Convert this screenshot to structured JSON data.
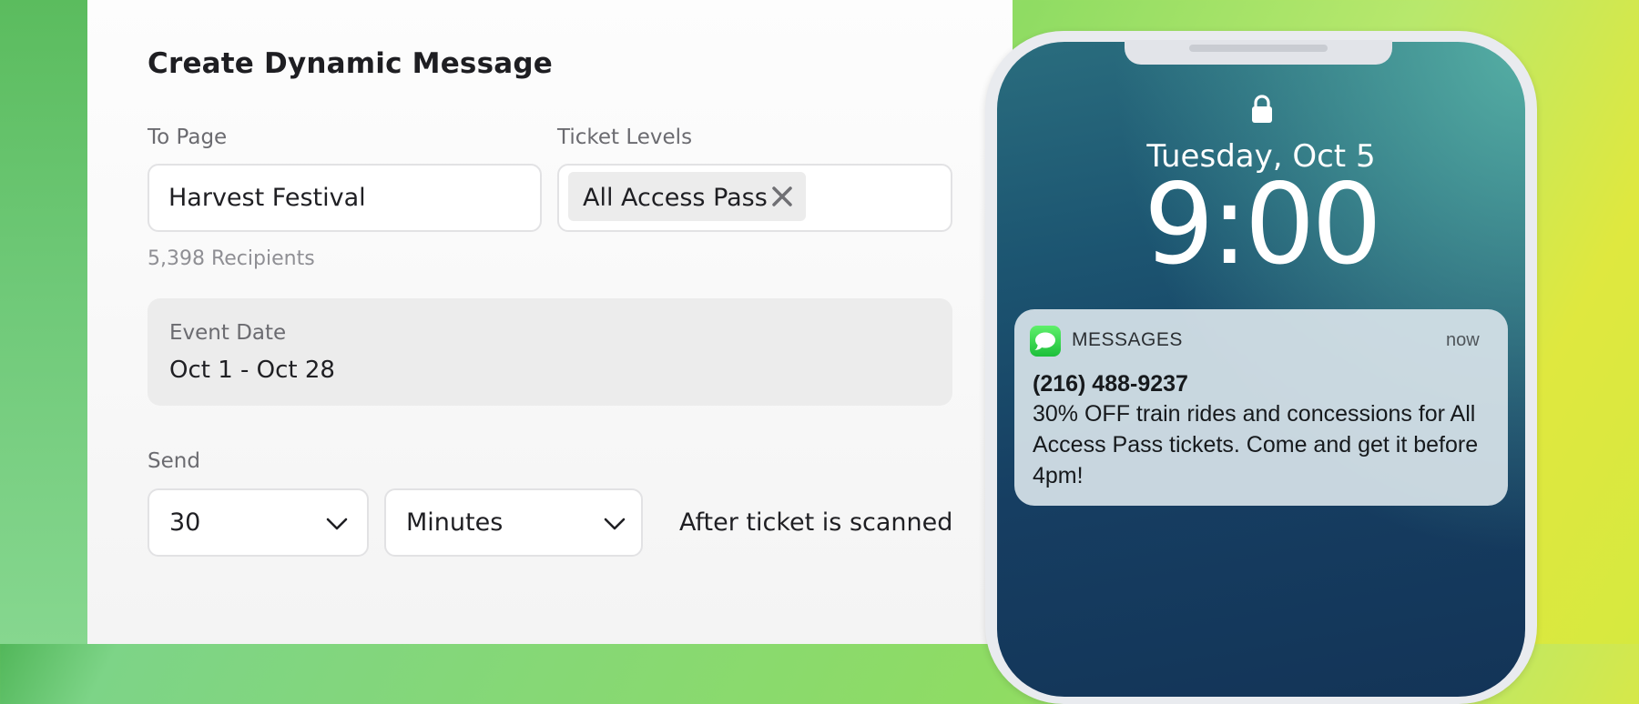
{
  "form": {
    "title": "Create Dynamic Message",
    "to_page": {
      "label": "To Page",
      "value": "Harvest Festival"
    },
    "ticket_levels": {
      "label": "Ticket Levels",
      "chips": [
        "All Access Pass"
      ]
    },
    "recipients": "5,398 Recipients",
    "event_date": {
      "label": "Event Date",
      "value": "Oct 1 - Oct 28"
    },
    "send": {
      "label": "Send",
      "amount": "30",
      "unit": "Minutes",
      "trigger": "After ticket is scanned"
    }
  },
  "phone": {
    "date": "Tuesday, Oct 5",
    "time": "9:00",
    "notification": {
      "app": "MESSAGES",
      "time": "now",
      "sender": "(216) 488-9237",
      "body": "30% OFF train rides and concessions for All Access Pass tickets. Come and get it before 4pm!",
      "icon": "messages-app-icon",
      "icon_color": "#2fd24a"
    },
    "lock_icon": "lock-icon"
  },
  "colors": {
    "panel_background": "#f7f7f7",
    "field_border": "#e2e2e4",
    "accent_green": "#8fdc63"
  }
}
